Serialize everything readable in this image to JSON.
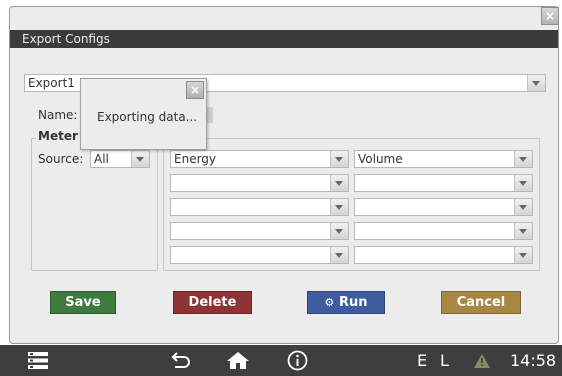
{
  "dialog": {
    "title": "Export Configs",
    "close_glyph": "×",
    "export_select": {
      "value": "Export1"
    },
    "name_label": "Name:",
    "meter_group": {
      "legend": "Meter",
      "source_label": "Source:",
      "source_value": "All"
    },
    "columns": {
      "left": [
        "Energy",
        "",
        "",
        "",
        ""
      ],
      "right": [
        "Volume",
        "",
        "",
        "",
        ""
      ]
    },
    "buttons": {
      "save": "Save",
      "delete": "Delete",
      "run": "Run",
      "cancel": "Cancel"
    },
    "colors": {
      "save": "#3f7a3f",
      "delete": "#8f3434",
      "run": "#3f5d9e",
      "cancel": "#a88743"
    }
  },
  "popup": {
    "message": "Exporting data...",
    "close_glyph": "×"
  },
  "taskbar": {
    "lang_e": "E",
    "lang_l": "L",
    "clock": "14:58",
    "icons": [
      "menu-icon",
      "back-icon",
      "home-icon",
      "info-icon",
      "warning-icon"
    ]
  }
}
